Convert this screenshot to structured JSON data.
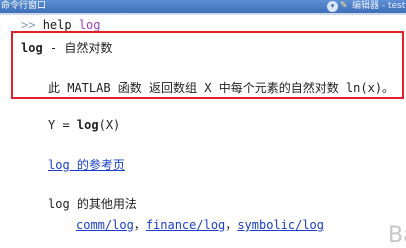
{
  "titlebar": {
    "title": "命令行窗口",
    "menu_icon": "chevron-down-icon",
    "editor_tab": "编辑器 - test.m"
  },
  "console": {
    "prompt_symbol": ">>",
    "command": "help",
    "argument": "log",
    "heading_keyword": "log",
    "heading_text": " - 自然对数",
    "description": "此 MATLAB 函数 返回数组 X 中每个元素的自然对数 ln(x)。",
    "syntax_lhs": "Y = ",
    "syntax_func": "log",
    "syntax_arg": "(X)",
    "ref_link": "log 的参考页",
    "other_usage_label": "log 的其他用法",
    "other_links": [
      "comm/log",
      "finance/log",
      "symbolic/log"
    ],
    "link_separator": "，"
  },
  "watermark": "Ba"
}
